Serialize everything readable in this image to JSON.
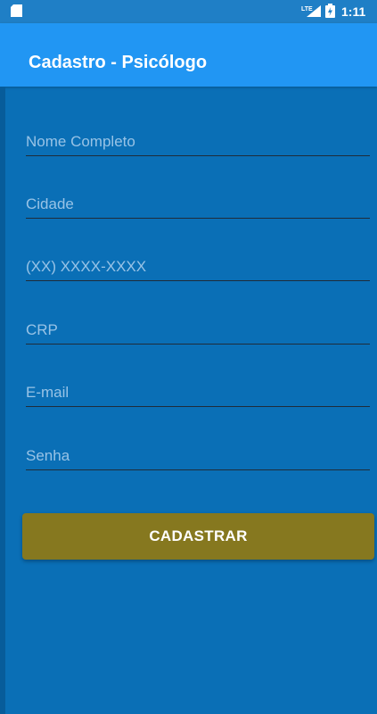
{
  "status_bar": {
    "time": "1:11",
    "network_label": "LTE",
    "icons": [
      "sd-card-icon",
      "lte-signal-icon",
      "battery-icon"
    ]
  },
  "app_bar": {
    "title": "Cadastro - Psicólogo"
  },
  "form": {
    "fields": [
      {
        "name": "nome",
        "placeholder": "Nome Completo",
        "value": ""
      },
      {
        "name": "cidade",
        "placeholder": "Cidade",
        "value": ""
      },
      {
        "name": "telefone",
        "placeholder": "(XX) XXXX-XXXX",
        "value": ""
      },
      {
        "name": "crp",
        "placeholder": "CRP",
        "value": ""
      },
      {
        "name": "email",
        "placeholder": "E-mail",
        "value": ""
      },
      {
        "name": "senha",
        "placeholder": "Senha",
        "value": ""
      }
    ],
    "submit_label": "CADASTRAR"
  },
  "colors": {
    "background": "#0a6fb6",
    "app_bar": "#2196f3",
    "status_bar": "#1f7fc6",
    "button": "#86781f",
    "placeholder": "#98c3e6"
  }
}
